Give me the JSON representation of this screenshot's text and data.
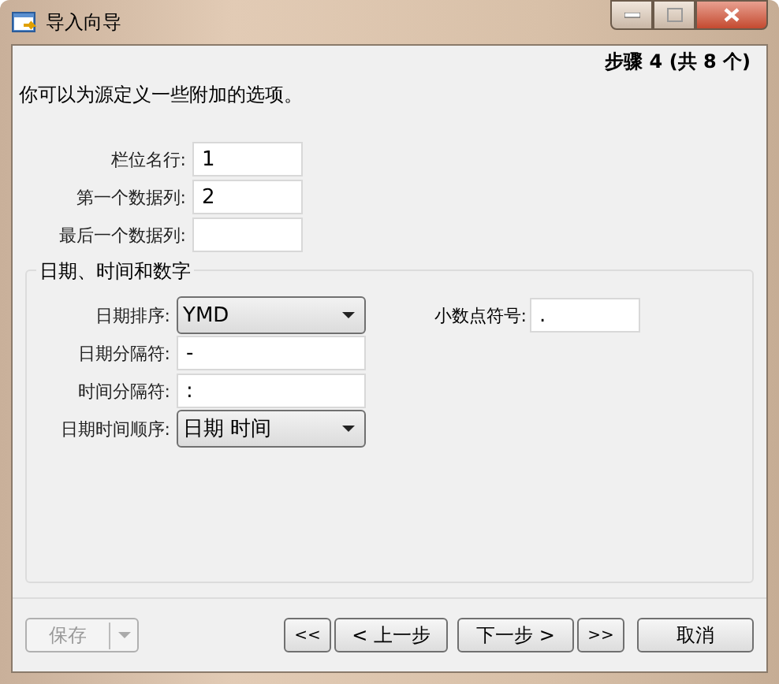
{
  "window": {
    "title": "导入向导"
  },
  "step": "步骤 4 (共 8 个)",
  "description": "你可以为源定义一些附加的选项。",
  "fields": [
    {
      "label": "栏位名行:",
      "value": "1"
    },
    {
      "label": "第一个数据列:",
      "value": "2"
    },
    {
      "label": "最后一个数据列:"
    }
  ],
  "group": {
    "title": "日期、时间和数字",
    "left": [
      {
        "kind": "dropdown",
        "label": "日期排序:",
        "value": "YMD"
      },
      {
        "kind": "text",
        "label": "日期分隔符:",
        "value": "-"
      },
      {
        "kind": "text",
        "label": "时间分隔符:",
        "value": ":"
      },
      {
        "kind": "dropdown",
        "label": "日期时间顺序:",
        "value": "日期 时间"
      }
    ],
    "decimal": {
      "label": "小数点符号:",
      "value": "."
    }
  },
  "save_button": {
    "label": "保存",
    "disabled": true
  },
  "buttons": [
    {
      "label": "<<"
    },
    {
      "label": "< 上一步"
    },
    {
      "label": "下一步 >"
    },
    {
      "label": ">>"
    },
    {
      "label": "取消"
    }
  ]
}
